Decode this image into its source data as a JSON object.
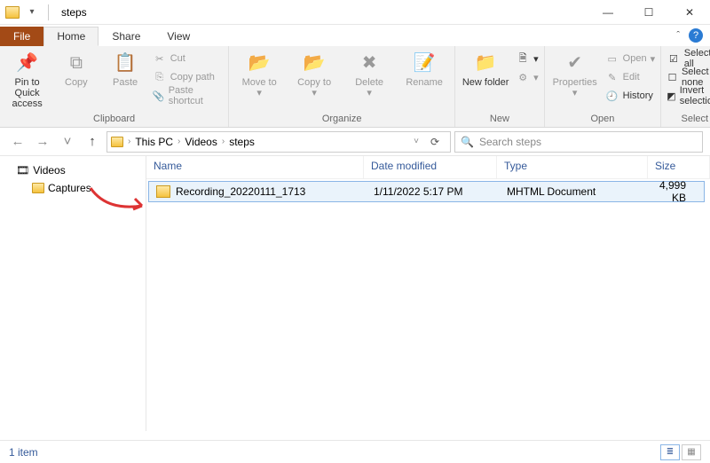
{
  "title": "steps",
  "window_controls": {
    "min": "—",
    "max": "☐",
    "close": "✕"
  },
  "tabs": {
    "file": "File",
    "home": "Home",
    "share": "Share",
    "view": "View"
  },
  "ribbon": {
    "clipboard": {
      "label": "Clipboard",
      "pin": "Pin to Quick access",
      "copy": "Copy",
      "paste": "Paste",
      "cut": "Cut",
      "copypath": "Copy path",
      "pasteshortcut": "Paste shortcut"
    },
    "organize": {
      "label": "Organize",
      "moveto": "Move to",
      "copyto": "Copy to",
      "delete": "Delete",
      "rename": "Rename"
    },
    "new": {
      "label": "New",
      "newfolder": "New folder"
    },
    "open": {
      "label": "Open",
      "properties": "Properties",
      "open": "Open",
      "edit": "Edit",
      "history": "History"
    },
    "select": {
      "label": "Select",
      "all": "Select all",
      "none": "Select none",
      "invert": "Invert selection"
    }
  },
  "nav": {
    "crumbs": [
      "This PC",
      "Videos",
      "steps"
    ]
  },
  "search": {
    "placeholder": "Search steps"
  },
  "tree": {
    "videos": "Videos",
    "captures": "Captures"
  },
  "columns": {
    "name": "Name",
    "date": "Date modified",
    "type": "Type",
    "size": "Size"
  },
  "files": [
    {
      "name": "Recording_20220111_1713",
      "date": "1/11/2022 5:17 PM",
      "type": "MHTML Document",
      "size": "4,999 KB"
    }
  ],
  "status": {
    "count": "1 item"
  }
}
